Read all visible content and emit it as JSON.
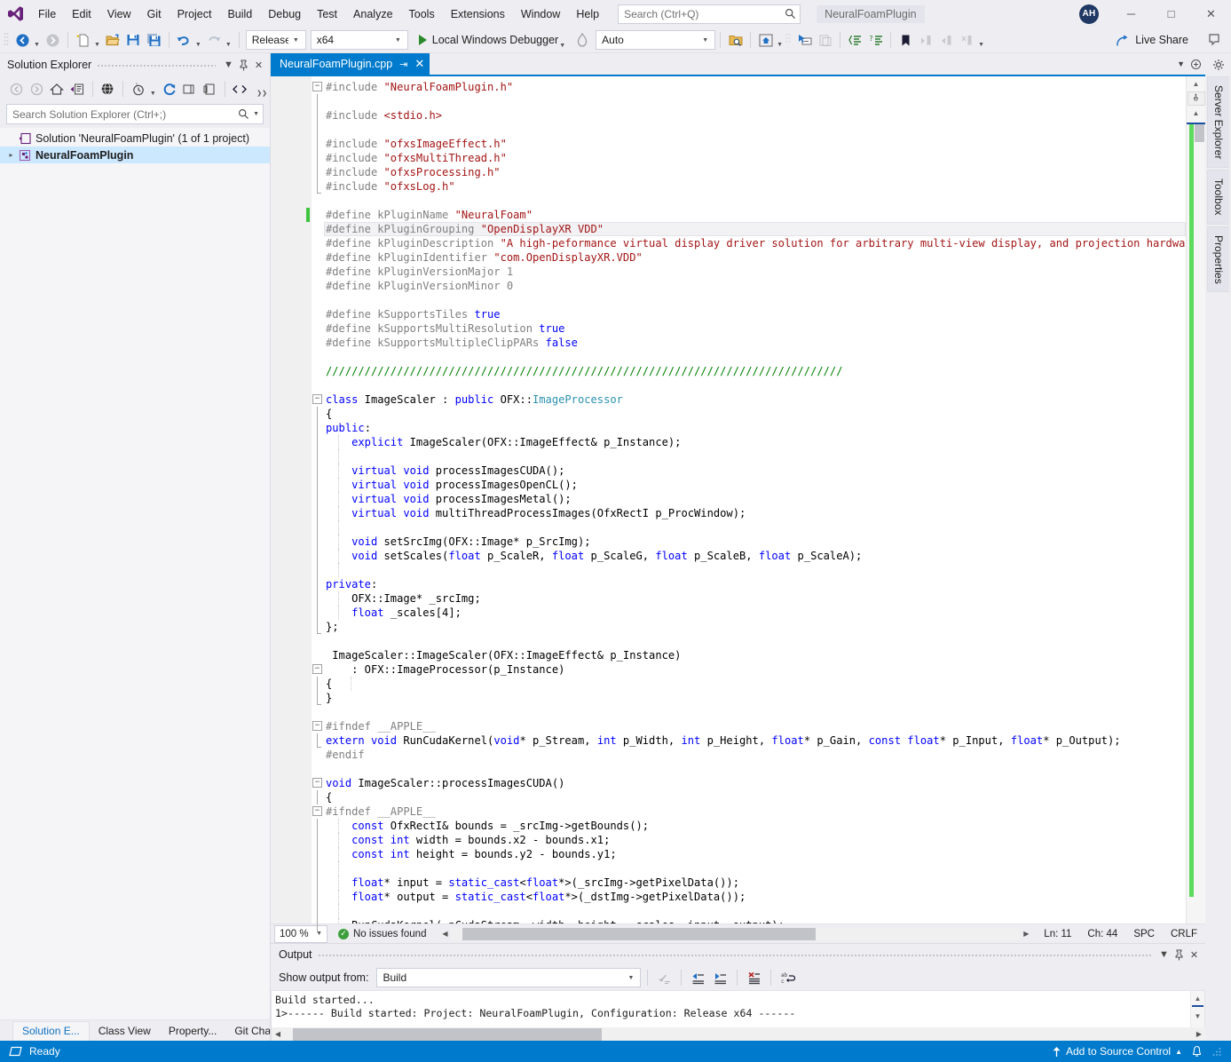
{
  "titlebar": {
    "logo_icon": "visual-studio-logo-icon",
    "menu": [
      {
        "label": "File"
      },
      {
        "label": "Edit"
      },
      {
        "label": "View"
      },
      {
        "label": "Git"
      },
      {
        "label": "Project"
      },
      {
        "label": "Build"
      },
      {
        "label": "Debug"
      },
      {
        "label": "Test"
      },
      {
        "label": "Analyze"
      },
      {
        "label": "Tools"
      },
      {
        "label": "Extensions"
      },
      {
        "label": "Window"
      },
      {
        "label": "Help"
      }
    ],
    "search_placeholder": "Search (Ctrl+Q)",
    "search_icon": "search-icon",
    "project_name": "NeuralFoamPlugin",
    "avatar_initials": "AH",
    "minimize_label": "─",
    "maximize_label": "□",
    "close_label": "✕"
  },
  "toolbar": {
    "nav_back_icon": "navigate-back-icon",
    "nav_forward_icon": "navigate-forward-icon",
    "new_file_icon": "new-file-icon",
    "open_file_icon": "open-folder-icon",
    "save_icon": "save-icon",
    "save_all_icon": "save-all-icon",
    "undo_icon": "undo-icon",
    "redo_icon": "redo-icon",
    "configuration": "Release",
    "platform": "x64",
    "debug_target": "Local Windows Debugger",
    "hot_reload_icon": "hot-reload-icon",
    "process_filter": "Auto",
    "find_in_files_icon": "find-in-files-icon",
    "solution_home_icon": "solution-home-icon",
    "pointer_select_icon": "pointer-select-icon",
    "copy_lines_icon": "copy-lines-icon",
    "comment_icon": "comment-selection-icon",
    "uncomment_icon": "uncomment-selection-icon",
    "bookmark_icon": "bookmark-icon",
    "prev_bookmark_icon": "previous-bookmark-icon",
    "next_bookmark_icon": "next-bookmark-icon",
    "clear_bookmarks_icon": "clear-bookmarks-icon",
    "overflow_icon": "toolbar-overflow-icon",
    "live_share_label": "Live Share",
    "live_share_icon": "live-share-icon",
    "feedback_icon": "feedback-icon"
  },
  "solution_explorer": {
    "title": "Solution Explorer",
    "dropdown_icon": "chevron-down-icon",
    "pin_icon": "pin-icon",
    "close_icon": "close-icon",
    "toolbar_icons": [
      "back-icon",
      "forward-icon",
      "home-icon",
      "sync-with-active-document-icon",
      "show-all-files-icon",
      "pending-changes-icon",
      "refresh-icon",
      "collapse-all-icon",
      "properties-icon",
      "view-code-icon"
    ],
    "overflow_icon": "toolbar-overflow-icon",
    "search_placeholder": "Search Solution Explorer (Ctrl+;)",
    "search_icon": "search-icon",
    "search_dropdown_icon": "chevron-down-icon",
    "tree": [
      {
        "label": "Solution 'NeuralFoamPlugin' (1 of 1 project)",
        "icon": "solution-icon",
        "bold": false,
        "selected": false,
        "expander": ""
      },
      {
        "label": "NeuralFoamPlugin",
        "icon": "cpp-project-icon",
        "bold": true,
        "selected": true,
        "expander": "▸"
      }
    ],
    "bottom_tabs": [
      {
        "label": "Solution E...",
        "active": true
      },
      {
        "label": "Class View",
        "active": false
      },
      {
        "label": "Property...",
        "active": false
      },
      {
        "label": "Git Changes",
        "active": false
      }
    ]
  },
  "editor": {
    "tab_label": "NeuralFoamPlugin.cpp",
    "tab_pin_icon": "pin-icon",
    "tab_close_icon": "close-icon",
    "tabstrip_overflow_icon": "chevron-down-icon",
    "tabstrip_menu_icon": "tab-list-icon",
    "scroll_up_icon": "scroll-up-arrow-icon",
    "scroll_split_icon": "split-view-icon",
    "scroll_collapse_icon": "scroll-collapse-icon",
    "lines": [
      {
        "t": "fold-open",
        "seg": [
          {
            "c": "pp",
            "s": "#include "
          },
          {
            "c": "str",
            "s": "\"NeuralFoamPlugin.h\""
          }
        ]
      },
      {
        "t": "bar",
        "seg": []
      },
      {
        "t": "bar",
        "seg": [
          {
            "c": "pp",
            "s": "#include "
          },
          {
            "c": "str",
            "s": "<stdio.h>"
          }
        ]
      },
      {
        "t": "bar",
        "seg": []
      },
      {
        "t": "bar",
        "seg": [
          {
            "c": "pp",
            "s": "#include "
          },
          {
            "c": "str",
            "s": "\"ofxsImageEffect.h\""
          }
        ]
      },
      {
        "t": "bar",
        "seg": [
          {
            "c": "pp",
            "s": "#include "
          },
          {
            "c": "str",
            "s": "\"ofxsMultiThread.h\""
          }
        ]
      },
      {
        "t": "bar",
        "seg": [
          {
            "c": "pp",
            "s": "#include "
          },
          {
            "c": "str",
            "s": "\"ofxsProcessing.h\""
          }
        ]
      },
      {
        "t": "bar-end",
        "seg": [
          {
            "c": "pp",
            "s": "#include "
          },
          {
            "c": "str",
            "s": "\"ofxsLog.h\""
          }
        ]
      },
      {
        "t": "",
        "seg": []
      },
      {
        "t": "change",
        "seg": [
          {
            "c": "pp",
            "s": "#define kPluginName "
          },
          {
            "c": "str",
            "s": "\"NeuralFoam\""
          }
        ]
      },
      {
        "t": "hl",
        "seg": [
          {
            "c": "pp",
            "s": "#define kPluginGrouping "
          },
          {
            "c": "str",
            "s": "\"OpenDisplayXR VDD\""
          }
        ]
      },
      {
        "t": "",
        "seg": [
          {
            "c": "pp",
            "s": "#define kPluginDescription "
          },
          {
            "c": "str",
            "s": "\"A high-peformance virtual display driver solution for arbitrary multi-view display, and projection hardware.\""
          }
        ]
      },
      {
        "t": "",
        "seg": [
          {
            "c": "pp",
            "s": "#define kPluginIdentifier "
          },
          {
            "c": "str",
            "s": "\"com.OpenDisplayXR.VDD\""
          }
        ]
      },
      {
        "t": "",
        "seg": [
          {
            "c": "pp",
            "s": "#define kPluginVersionMajor 1"
          }
        ]
      },
      {
        "t": "",
        "seg": [
          {
            "c": "pp",
            "s": "#define kPluginVersionMinor 0"
          }
        ]
      },
      {
        "t": "",
        "seg": []
      },
      {
        "t": "",
        "seg": [
          {
            "c": "pp",
            "s": "#define kSupportsTiles "
          },
          {
            "c": "kw",
            "s": "true"
          }
        ]
      },
      {
        "t": "",
        "seg": [
          {
            "c": "pp",
            "s": "#define kSupportsMultiResolution "
          },
          {
            "c": "kw",
            "s": "true"
          }
        ]
      },
      {
        "t": "",
        "seg": [
          {
            "c": "pp",
            "s": "#define kSupportsMultipleClipPARs "
          },
          {
            "c": "kw",
            "s": "false"
          }
        ]
      },
      {
        "t": "",
        "seg": []
      },
      {
        "t": "",
        "seg": [
          {
            "c": "cmt",
            "s": "////////////////////////////////////////////////////////////////////////////////"
          }
        ]
      },
      {
        "t": "",
        "seg": []
      },
      {
        "t": "fold-open",
        "seg": [
          {
            "c": "kw",
            "s": "class"
          },
          {
            "c": "pl",
            "s": " ImageScaler : "
          },
          {
            "c": "kw",
            "s": "public"
          },
          {
            "c": "pl",
            "s": " OFX::"
          },
          {
            "c": "typ",
            "s": "ImageProcessor"
          }
        ]
      },
      {
        "t": "bar",
        "seg": [
          {
            "c": "pl",
            "s": "{"
          }
        ]
      },
      {
        "t": "bar",
        "seg": [
          {
            "c": "kw",
            "s": "public"
          },
          {
            "c": "pl",
            "s": ":"
          }
        ]
      },
      {
        "t": "bar-dot",
        "seg": [
          {
            "c": "pl",
            "s": "    "
          },
          {
            "c": "kw",
            "s": "explicit"
          },
          {
            "c": "pl",
            "s": " ImageScaler(OFX::ImageEffect& p_Instance);"
          }
        ]
      },
      {
        "t": "bar-dot",
        "seg": []
      },
      {
        "t": "bar-dot",
        "seg": [
          {
            "c": "pl",
            "s": "    "
          },
          {
            "c": "kw",
            "s": "virtual void"
          },
          {
            "c": "pl",
            "s": " processImagesCUDA();"
          }
        ]
      },
      {
        "t": "bar-dot",
        "seg": [
          {
            "c": "pl",
            "s": "    "
          },
          {
            "c": "kw",
            "s": "virtual void"
          },
          {
            "c": "pl",
            "s": " processImagesOpenCL();"
          }
        ]
      },
      {
        "t": "bar-dot",
        "seg": [
          {
            "c": "pl",
            "s": "    "
          },
          {
            "c": "kw",
            "s": "virtual void"
          },
          {
            "c": "pl",
            "s": " processImagesMetal();"
          }
        ]
      },
      {
        "t": "bar-dot",
        "seg": [
          {
            "c": "pl",
            "s": "    "
          },
          {
            "c": "kw",
            "s": "virtual void"
          },
          {
            "c": "pl",
            "s": " multiThreadProcessImages(OfxRectI p_ProcWindow);"
          }
        ]
      },
      {
        "t": "bar-dot",
        "seg": []
      },
      {
        "t": "bar-dot",
        "seg": [
          {
            "c": "pl",
            "s": "    "
          },
          {
            "c": "kw",
            "s": "void"
          },
          {
            "c": "pl",
            "s": " setSrcImg(OFX::Image* p_SrcImg);"
          }
        ]
      },
      {
        "t": "bar-dot",
        "seg": [
          {
            "c": "pl",
            "s": "    "
          },
          {
            "c": "kw",
            "s": "void"
          },
          {
            "c": "pl",
            "s": " setScales("
          },
          {
            "c": "kw",
            "s": "float"
          },
          {
            "c": "pl",
            "s": " p_ScaleR, "
          },
          {
            "c": "kw",
            "s": "float"
          },
          {
            "c": "pl",
            "s": " p_ScaleG, "
          },
          {
            "c": "kw",
            "s": "float"
          },
          {
            "c": "pl",
            "s": " p_ScaleB, "
          },
          {
            "c": "kw",
            "s": "float"
          },
          {
            "c": "pl",
            "s": " p_ScaleA);"
          }
        ]
      },
      {
        "t": "bar-dot",
        "seg": []
      },
      {
        "t": "bar",
        "seg": [
          {
            "c": "kw",
            "s": "private"
          },
          {
            "c": "pl",
            "s": ":"
          }
        ]
      },
      {
        "t": "bar-dot",
        "seg": [
          {
            "c": "pl",
            "s": "    OFX::Image* _srcImg;"
          }
        ]
      },
      {
        "t": "bar-dot",
        "seg": [
          {
            "c": "pl",
            "s": "    "
          },
          {
            "c": "kw",
            "s": "float"
          },
          {
            "c": "pl",
            "s": " _scales[4];"
          }
        ]
      },
      {
        "t": "bar-end",
        "seg": [
          {
            "c": "pl",
            "s": "};"
          }
        ]
      },
      {
        "t": "",
        "seg": []
      },
      {
        "t": "",
        "seg": [
          {
            "c": "pl",
            "s": " ImageScaler::ImageScaler(OFX::ImageEffect& p_Instance)"
          }
        ]
      },
      {
        "t": "fold-open",
        "seg": [
          {
            "c": "pl",
            "s": "    : OFX::ImageProcessor(p_Instance)"
          }
        ]
      },
      {
        "t": "bar-dot2",
        "seg": [
          {
            "c": "pl",
            "s": "{"
          }
        ]
      },
      {
        "t": "bar-end",
        "seg": [
          {
            "c": "pl",
            "s": "}"
          }
        ]
      },
      {
        "t": "",
        "seg": []
      },
      {
        "t": "fold-open",
        "seg": [
          {
            "c": "pp",
            "s": "#ifndef __APPLE__"
          }
        ]
      },
      {
        "t": "bar-end",
        "seg": [
          {
            "c": "kw",
            "s": "extern void"
          },
          {
            "c": "pl",
            "s": " RunCudaKernel("
          },
          {
            "c": "kw",
            "s": "void"
          },
          {
            "c": "pl",
            "s": "* p_Stream, "
          },
          {
            "c": "kw",
            "s": "int"
          },
          {
            "c": "pl",
            "s": " p_Width, "
          },
          {
            "c": "kw",
            "s": "int"
          },
          {
            "c": "pl",
            "s": " p_Height, "
          },
          {
            "c": "kw",
            "s": "float"
          },
          {
            "c": "pl",
            "s": "* p_Gain, "
          },
          {
            "c": "kw",
            "s": "const float"
          },
          {
            "c": "pl",
            "s": "* p_Input, "
          },
          {
            "c": "kw",
            "s": "float"
          },
          {
            "c": "pl",
            "s": "* p_Output);"
          }
        ]
      },
      {
        "t": "",
        "seg": [
          {
            "c": "pp",
            "s": "#endif"
          }
        ]
      },
      {
        "t": "",
        "seg": []
      },
      {
        "t": "fold-open",
        "seg": [
          {
            "c": "kw",
            "s": "void"
          },
          {
            "c": "pl",
            "s": " ImageScaler::processImagesCUDA()"
          }
        ]
      },
      {
        "t": "bar",
        "seg": [
          {
            "c": "pl",
            "s": "{"
          }
        ]
      },
      {
        "t": "fold-open2",
        "seg": [
          {
            "c": "pp",
            "s": "#ifndef __APPLE__"
          }
        ]
      },
      {
        "t": "bar-dot",
        "seg": [
          {
            "c": "pl",
            "s": "    "
          },
          {
            "c": "kw",
            "s": "const"
          },
          {
            "c": "pl",
            "s": " OfxRectI& bounds = _srcImg->getBounds();"
          }
        ]
      },
      {
        "t": "bar-dot",
        "seg": [
          {
            "c": "pl",
            "s": "    "
          },
          {
            "c": "kw",
            "s": "const int"
          },
          {
            "c": "pl",
            "s": " width = bounds.x2 - bounds.x1;"
          }
        ]
      },
      {
        "t": "bar-dot",
        "seg": [
          {
            "c": "pl",
            "s": "    "
          },
          {
            "c": "kw",
            "s": "const int"
          },
          {
            "c": "pl",
            "s": " height = bounds.y2 - bounds.y1;"
          }
        ]
      },
      {
        "t": "bar-dot",
        "seg": []
      },
      {
        "t": "bar-dot",
        "seg": [
          {
            "c": "pl",
            "s": "    "
          },
          {
            "c": "kw",
            "s": "float"
          },
          {
            "c": "pl",
            "s": "* input = "
          },
          {
            "c": "kw",
            "s": "static_cast"
          },
          {
            "c": "pl",
            "s": "<"
          },
          {
            "c": "kw",
            "s": "float"
          },
          {
            "c": "pl",
            "s": "*>(_srcImg->getPixelData());"
          }
        ]
      },
      {
        "t": "bar-dot",
        "seg": [
          {
            "c": "pl",
            "s": "    "
          },
          {
            "c": "kw",
            "s": "float"
          },
          {
            "c": "pl",
            "s": "* output = "
          },
          {
            "c": "kw",
            "s": "static_cast"
          },
          {
            "c": "pl",
            "s": "<"
          },
          {
            "c": "kw",
            "s": "float"
          },
          {
            "c": "pl",
            "s": "*>(_dstImg->getPixelData());"
          }
        ]
      },
      {
        "t": "bar-dot",
        "seg": []
      },
      {
        "t": "bar-dot",
        "seg": [
          {
            "c": "pl",
            "s": "    RunCudaKernel( pCudaStream, width, height,  scales, input, output);"
          }
        ]
      }
    ],
    "status": {
      "zoom": "100 %",
      "zoom_caret_icon": "chevron-down-icon",
      "issues_icon": "no-issues-icon",
      "issues_text": "No issues found",
      "line_label": "Ln: 11",
      "column_label": "Ch: 44",
      "spaces_label": "SPC",
      "line_ending_label": "CRLF",
      "hscroll_left_icon": "scroll-left-arrow-icon",
      "hscroll_right_icon": "scroll-right-arrow-icon"
    }
  },
  "output": {
    "title": "Output",
    "dropdown_icon": "chevron-down-icon",
    "pin_icon": "pin-icon",
    "close_icon": "close-icon",
    "source_label": "Show output from:",
    "source_value": "Build",
    "source_caret_icon": "chevron-down-icon",
    "toolbar_icons": [
      "find-message-icon",
      "go-to-previous-message-icon",
      "go-to-next-message-icon",
      "clear-all-icon",
      "toggle-word-wrap-icon"
    ],
    "lines": [
      "Build started...",
      "1>------ Build started: Project: NeuralFoamPlugin, Configuration: Release x64 ------"
    ],
    "scroll_up_icon": "scroll-up-arrow-icon",
    "scroll_down_icon": "scroll-down-arrow-icon",
    "hscroll_left_icon": "scroll-left-arrow-icon",
    "hscroll_right_icon": "scroll-right-arrow-icon"
  },
  "right_rail": {
    "tabs": [
      {
        "label": "Server Explorer"
      },
      {
        "label": "Toolbox"
      },
      {
        "label": "Properties"
      }
    ],
    "gear_icon": "gear-icon"
  },
  "statusbar": {
    "ready_icon": "ready-icon",
    "ready_text": "Ready",
    "source_control_icon": "arrow-up-icon",
    "source_control_text": "Add to Source Control",
    "source_control_caret_icon": "chevron-up-icon",
    "notifications_icon": "bell-icon",
    "accent_color": "#007acc"
  }
}
